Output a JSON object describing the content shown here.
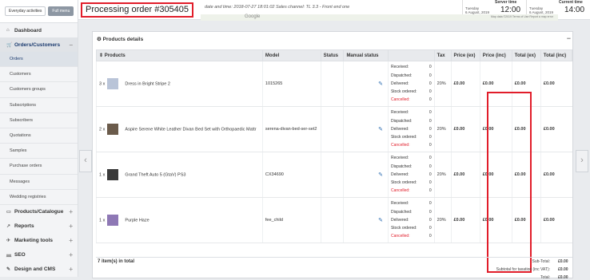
{
  "sidebar": {
    "buttons": [
      "Everyday activities",
      "Full menu"
    ],
    "top_items": [
      {
        "icon": "⌂",
        "label": "Dashboard"
      }
    ],
    "section": {
      "icon": "🛒",
      "label": "Orders/Customers",
      "toggle": "−"
    },
    "sub_items": [
      "Orders",
      "Customers",
      "Customers groups",
      "Subscriptions",
      "Subscribers",
      "Quotations",
      "Samples",
      "Purchase orders",
      "Messages",
      "Wedding registries"
    ],
    "bottom_items": [
      {
        "icon": "▭",
        "label": "Products/Catalogue",
        "toggle": "+"
      },
      {
        "icon": "↗",
        "label": "Reports",
        "toggle": "+"
      },
      {
        "icon": "✈",
        "label": "Marketing tools",
        "toggle": "+"
      },
      {
        "icon": "⅏",
        "label": "SEO",
        "toggle": "+"
      },
      {
        "icon": "✎",
        "label": "Design and CMS",
        "toggle": "+"
      }
    ]
  },
  "header": {
    "title": "Processing order #305405",
    "meta": "date and time: 2018-07-27 18:01:02  Sales channel: TL 3.3 - Front end one",
    "server_time": {
      "label": "Server time",
      "day": "Tuesday",
      "date": "6 August, 2019",
      "time": "12:00"
    },
    "current_time": {
      "label": "Current time",
      "day": "Tuesday",
      "date": "6 August, 2019",
      "time": "14:00"
    }
  },
  "map": {
    "google": "Google",
    "attribution": "Map data ©2019   Terms of Use   Report a map error"
  },
  "panel": {
    "title": "Products details",
    "collapse": "−"
  },
  "table": {
    "headers": [
      "Products",
      "Model",
      "Status",
      "Manual status",
      "Tax",
      "Price (ex)",
      "Price (inc)",
      "Total (ex)",
      "Total (inc)"
    ],
    "status_labels": [
      "Received:",
      "Dispatched:",
      "Delivered:",
      "Stock ordered:",
      "Cancelled:"
    ],
    "rows": [
      {
        "qty": "3 x",
        "name": "Dress in Bright Stripe 2",
        "model": "1015265",
        "status_values": [
          "0",
          "0",
          "0",
          "0",
          "0"
        ],
        "tax": "20%",
        "price_ex": "£0.00",
        "price_inc": "£0.00",
        "total_ex": "£0.00",
        "total_inc": "£0.00"
      },
      {
        "qty": "2 x",
        "name": "Aspire Serene White Leather Divan Bed Set with Orthopaedic Mattr",
        "model": "serena-divan-bed-ser-set2",
        "status_values": [
          "0",
          "0",
          "0",
          "0",
          "0"
        ],
        "tax": "20%",
        "price_ex": "£0.00",
        "price_inc": "£0.00",
        "total_ex": "£0.00",
        "total_inc": "£0.00"
      },
      {
        "qty": "1 x",
        "name": "Grand Theft Auto 5 (GtaV) PS3",
        "model": "CX34690",
        "status_values": [
          "0",
          "0",
          "0",
          "0",
          "0"
        ],
        "tax": "20%",
        "price_ex": "£0.00",
        "price_inc": "£0.00",
        "total_ex": "£0.00",
        "total_inc": "£0.00"
      },
      {
        "qty": "1 x",
        "name": "Purple Haze",
        "model": "fee_child",
        "status_values": [
          "0",
          "0",
          "0",
          "0",
          "0"
        ],
        "tax": "20%",
        "price_ex": "£0.00",
        "price_inc": "£0.00",
        "total_ex": "£0.00",
        "total_inc": "£0.00"
      }
    ]
  },
  "footer": {
    "items_count": "7 item(s) in total",
    "totals": [
      {
        "label": "Sub-Total:",
        "value": "£0.00"
      },
      {
        "label": "Subtotal for taxation (inc VAT):",
        "value": "£0.00"
      },
      {
        "label": "Total:",
        "value": "£0.00"
      }
    ]
  },
  "colors": {
    "highlight": "#e11d2a",
    "link": "#2b6cb0",
    "cancelled": "#e11d2a"
  }
}
